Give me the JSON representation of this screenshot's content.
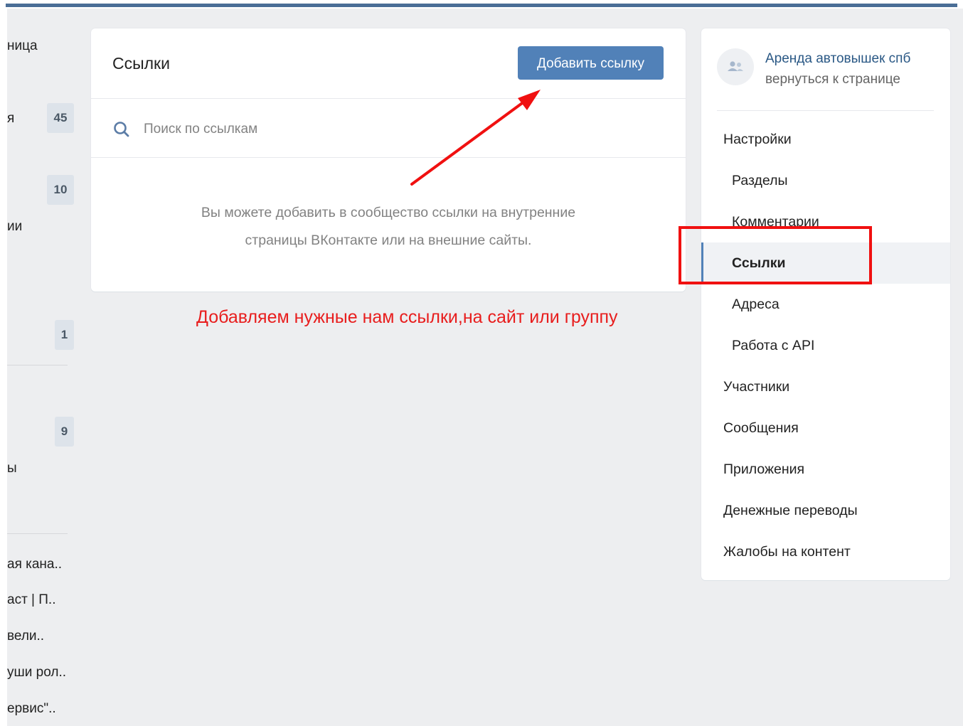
{
  "left_menu": {
    "items": [
      {
        "label": "ница"
      },
      {
        "label": "я",
        "badge": "45"
      },
      {
        "label": "",
        "badge": "10"
      },
      {
        "label": "ии"
      },
      {
        "label": "",
        "badge": "1"
      },
      {
        "label": "",
        "badge": "9"
      },
      {
        "label": "ы"
      },
      {
        "label": "ая кана.."
      },
      {
        "label": "аст | П.."
      },
      {
        "label": "вели.."
      },
      {
        "label": "уши рол.."
      },
      {
        "label": "ервис\".."
      }
    ]
  },
  "panel": {
    "title": "Ссылки",
    "add_button": "Добавить ссылку",
    "search_placeholder": "Поиск по ссылкам",
    "empty_line1": "Вы можете добавить в сообщество ссылки на внутренние",
    "empty_line2": "страницы ВКонтакте или на внешние сайты."
  },
  "annotation": {
    "text": "Добавляем нужные нам ссылки,на сайт или группу",
    "color": "#e81d1d"
  },
  "right_menu": {
    "group_name": "Аренда автовышек спб",
    "back_link": "вернуться к странице",
    "items": [
      {
        "label": "Настройки",
        "level": "top"
      },
      {
        "label": "Разделы",
        "level": "sub"
      },
      {
        "label": "Комментарии",
        "level": "sub"
      },
      {
        "label": "Ссылки",
        "level": "sub",
        "active": true
      },
      {
        "label": "Адреса",
        "level": "sub"
      },
      {
        "label": "Работа с API",
        "level": "sub"
      },
      {
        "label": "Участники",
        "level": "top"
      },
      {
        "label": "Сообщения",
        "level": "top"
      },
      {
        "label": "Приложения",
        "level": "top"
      },
      {
        "label": "Денежные переводы",
        "level": "top"
      },
      {
        "label": "Жалобы на контент",
        "level": "top"
      }
    ]
  },
  "colors": {
    "accent": "#5181b8",
    "topbar": "#4a6e96",
    "background": "#edeef0",
    "link": "#2a5885"
  },
  "icons": [
    "search-icon",
    "group-avatar-icon",
    "arrow-annotation-icon"
  ]
}
